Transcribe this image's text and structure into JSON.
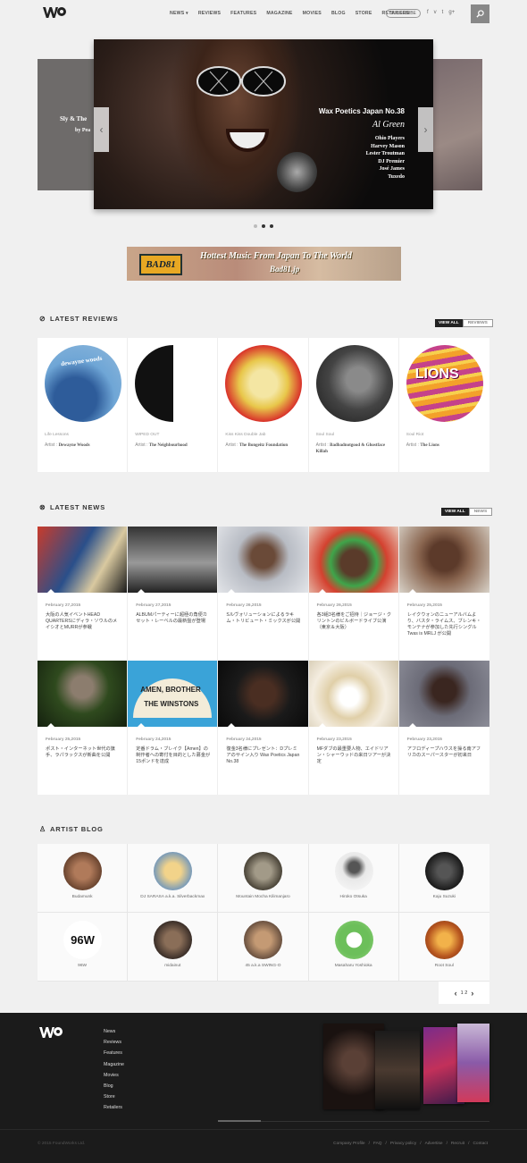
{
  "header": {
    "nav": [
      "NEWS ▾",
      "REVIEWS",
      "FEATURES",
      "MAGAZINE",
      "MOVIES",
      "BLOG",
      "STORE",
      "RETAILERS"
    ],
    "subscribe": "SUBSCRIBE",
    "social": [
      "f",
      "v",
      "t",
      "g+"
    ],
    "search_icon": "search-icon"
  },
  "slider": {
    "left_title": "Sly & The",
    "left_sub": "by Pea",
    "issue": "Wax Poetics Japan No.38",
    "cover_star": "Al Green",
    "subjects": [
      "Ohio Players",
      "Harvey Mason",
      "Lester Troutman",
      "DJ Premier",
      "José James",
      "Tuxedo"
    ],
    "prev": "‹",
    "next": "›"
  },
  "banner": {
    "badge": "BAD81",
    "tagline": "Hottest Music From Japan To The World",
    "url": "Bad81.jp"
  },
  "reviews": {
    "title": "LATEST REVIEWS",
    "view_all": "VIEW ALL",
    "tag": "REVIEWS",
    "items": [
      {
        "genre": "Life Lessons",
        "artist_label": "Artist : ",
        "artist": "Dewayne Woods"
      },
      {
        "genre": "WIPED OUT",
        "artist_label": "Artist : ",
        "artist": "The Neighbourhood"
      },
      {
        "genre": "Kiss Kiss Double Jab",
        "artist_label": "Artist : ",
        "artist": "The Bongeitz Foundation"
      },
      {
        "genre": "Soul Soul",
        "artist_label": "Artist : ",
        "artist": "Badbadnotgood & Ghostface Killah"
      },
      {
        "genre": "Soul Riot",
        "artist_label": "Artist : ",
        "artist": "The Lions"
      }
    ]
  },
  "news": {
    "title": "LATEST NEWS",
    "view_all": "VIEW ALL",
    "tag": "NEWS",
    "row1": [
      {
        "date": "February 27,2015",
        "text": "大阪の人気イベントHEAD QUARTERSにディラ・ソウルのメイシオとMURRが参戦"
      },
      {
        "date": "February 27,2015",
        "text": "ALBUMパーティーに超極の角便カセット・レーベルの最新盤が登場"
      },
      {
        "date": "February 26,2015",
        "text": "Sルヴォリューションによるラキム・トリビュート・ミックスが公開"
      },
      {
        "date": "February 26,2015",
        "text": "各3組3名様をご招待｜ジョージ・クリントンのビルボードライブ公演（東京＆大阪）"
      },
      {
        "date": "February 25,2015",
        "text": "レイクウォンのニューアルバムより、バスタ・ライムス、ブレンキ・モンテナが参加した先行シングル Twas is MRLJ が公開"
      }
    ],
    "row2": [
      {
        "date": "February 25,2015",
        "text": "ポスト・インターネット世代の旗手、ラパラックスが新曲を公開"
      },
      {
        "date": "February 24,2015",
        "text": "定番ドラム・ブレイク【Amen】の制作者への寄付を目的とした募金が15ポンドを達成"
      },
      {
        "date": "February 24,2015",
        "text": "復金3名様にプレゼント：Dプレミアのサイン入り Wax Poetics Japan No.38"
      },
      {
        "date": "February 23,2015",
        "text": "MFダブの最重要人物、エイドリアン・シャーウッドの来日ツアーが決定"
      },
      {
        "date": "February 23,2015",
        "text": "アフロディープハウスを操る南アフリカのスーパースターが初来日"
      }
    ]
  },
  "blog": {
    "title": "ARTIST BLOG",
    "items": [
      "Budamunk",
      "DJ SARASA a.k.a. Silverbackmax",
      "Mountain Mocha Kilimanjaro",
      "Hiroko Otsuka",
      "Kaju Suzuki",
      "96W",
      "midainut",
      "45 a.k.a SWING-O",
      "Masaharu Yoshioka",
      "Root Soul"
    ],
    "pager": {
      "prev": "‹",
      "pages": "1  2",
      "next": "›"
    }
  },
  "footer": {
    "links": [
      "News",
      "Reviews",
      "Features",
      "Magazine",
      "Movies",
      "Blog",
      "Store",
      "Retailers"
    ],
    "copyright": "© 2015 FoundWorks Ltd.",
    "bottom_links": [
      "Company Profile",
      "/",
      "FAQ",
      "/",
      "Privacy policy",
      "/",
      "Advertise",
      "/",
      "Recruit",
      "/",
      "Contact"
    ]
  }
}
